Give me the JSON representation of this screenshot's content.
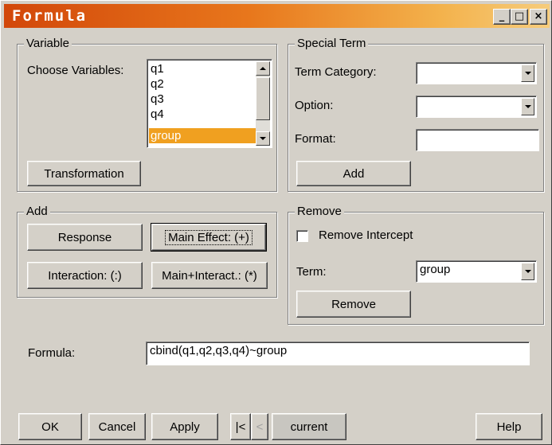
{
  "window": {
    "title": "Formula",
    "minimize_glyph": "_",
    "maximize_glyph": "□",
    "close_glyph": "×"
  },
  "variable": {
    "legend": "Variable",
    "choose_label": "Choose Variables:",
    "items": [
      "q1",
      "q2",
      "q3",
      "q4",
      "group"
    ],
    "selected": "group",
    "transformation_label": "Transformation"
  },
  "special_term": {
    "legend": "Special Term",
    "term_category_label": "Term Category:",
    "term_category_value": "",
    "option_label": "Option:",
    "option_value": "",
    "format_label": "Format:",
    "format_value": "",
    "add_label": "Add"
  },
  "add": {
    "legend": "Add",
    "response_label": "Response",
    "main_effect_label": "Main Effect: (+)",
    "interaction_label": "Interaction: (:)",
    "main_interact_label": "Main+Interact.: (*)"
  },
  "remove": {
    "legend": "Remove",
    "remove_intercept_label": "Remove Intercept",
    "remove_intercept_checked": false,
    "term_label": "Term:",
    "term_value": "group",
    "remove_label": "Remove"
  },
  "formula": {
    "label": "Formula:",
    "value": "cbind(q1,q2,q3,q4)~group"
  },
  "footer": {
    "ok_label": "OK",
    "cancel_label": "Cancel",
    "apply_label": "Apply",
    "first_glyph": "|<",
    "prev_glyph": "<",
    "current_label": "current",
    "help_label": "Help"
  },
  "colors": {
    "dialog_face": "#d4d0c8",
    "title_start": "#d2470a",
    "title_end": "#f6cc7c",
    "selection": "#f0a020"
  }
}
